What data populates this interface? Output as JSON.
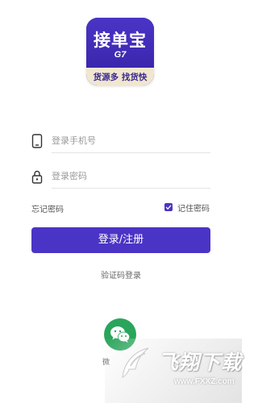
{
  "app_logo": {
    "title": "接单宝",
    "subtitle": "G7",
    "slogan": "货源多 找货快"
  },
  "form": {
    "phone_placeholder": "登录手机号",
    "password_placeholder": "登录密码",
    "phone_icon": "phone-icon",
    "lock_icon": "lock-icon"
  },
  "options": {
    "forgot_password": "忘记密码",
    "remember_password": "记住密码",
    "remember_checked": true
  },
  "login_button": "登录/注册",
  "sms_login": "验证码登录",
  "wechat": {
    "label": "微",
    "icon": "wechat-icon"
  },
  "watermark": {
    "title": "飞翔下载",
    "url": "www.FXXZ.com"
  },
  "colors": {
    "accent": "#4a34c6",
    "wechat_green": "#2aa55b",
    "logo_bottom": "#f1e7cf"
  }
}
